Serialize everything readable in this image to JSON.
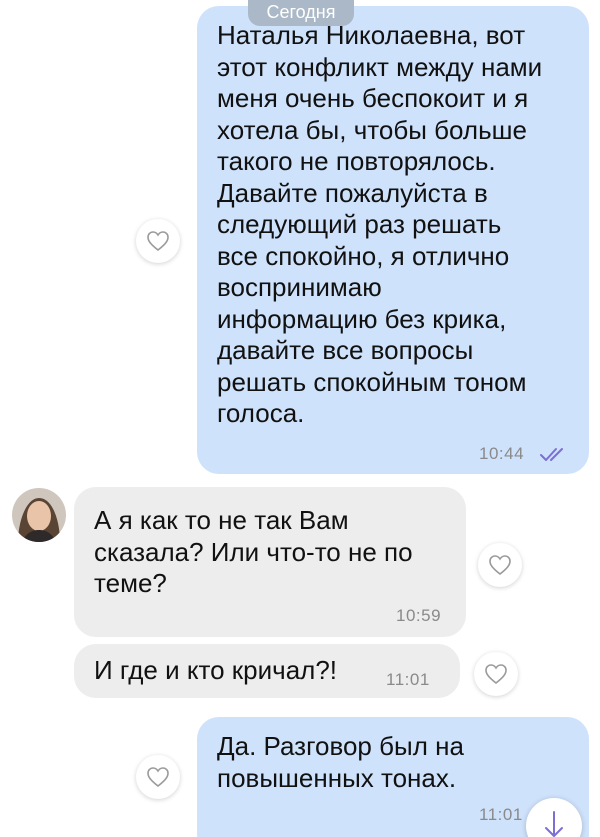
{
  "date_label": "Сегодня",
  "messages": [
    {
      "direction": "outgoing",
      "text": "Наталья Николаевна, вот\nэтот конфликт между нами\nменя очень беспокоит и я\nхотела бы, чтобы больше\nтакого не повторялось.\nДавайте пожалуйста в\nследующий раз решать\nвсе спокойно, я отлично\nвоспринимаю\nинформацию без крика,\nдавайте все вопросы\nрешать спокойным тоном\nголоса.",
      "time": "10:44",
      "status": "read"
    },
    {
      "direction": "incoming",
      "text": "А я как то не так Вам\nсказала? Или что-то не по\nтеме?",
      "time": "10:59"
    },
    {
      "direction": "incoming",
      "text": "И где и кто кричал?!",
      "time": "11:01"
    },
    {
      "direction": "outgoing",
      "text": "Да. Разговор был на\nповышенных тонах.",
      "time": "11:01"
    }
  ],
  "icons": {
    "like": "heart-outline-icon",
    "read_status": "double-check-icon",
    "scroll_down": "arrow-down-icon"
  },
  "colors": {
    "outgoing_bubble": "#cfe2fb",
    "incoming_bubble": "#ededed",
    "check_color": "#7b6fd6",
    "date_pill": "#aab8c8"
  }
}
